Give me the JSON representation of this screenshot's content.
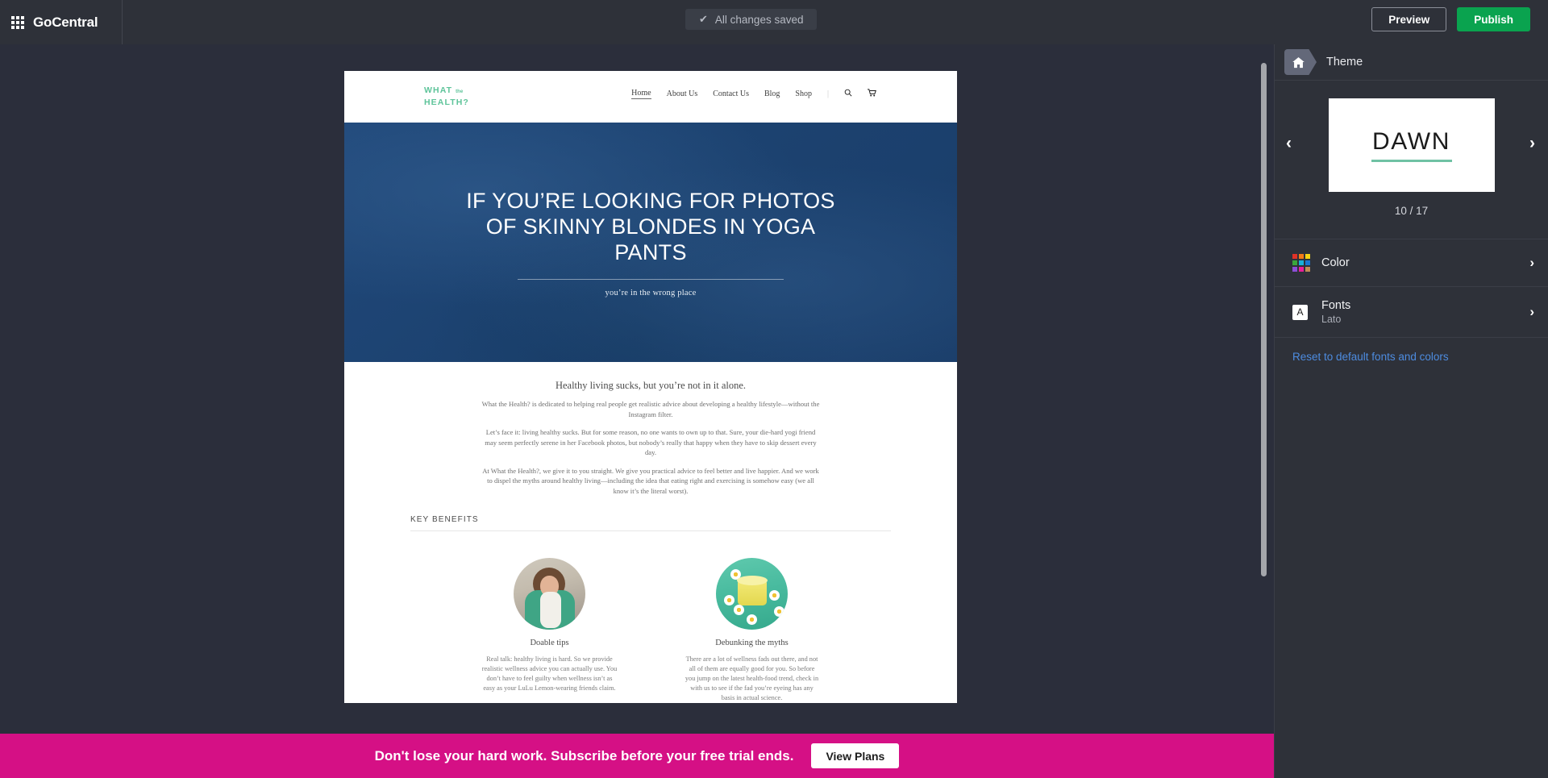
{
  "topbar": {
    "brand": "GoCentral",
    "waffle_icon": "apps-grid-icon",
    "save_status": "All changes saved",
    "check_glyph": "✔",
    "preview_label": "Preview",
    "publish_label": "Publish",
    "publish_color": "#0aa34f"
  },
  "site": {
    "logo_line1": "WHAT",
    "logo_small": "the",
    "logo_line2": "HEALTH",
    "logo_mark": "?",
    "logo_color": "#5ec49a",
    "nav": [
      {
        "label": "Home",
        "active": true
      },
      {
        "label": "About Us",
        "active": false
      },
      {
        "label": "Contact Us",
        "active": false
      },
      {
        "label": "Blog",
        "active": false
      },
      {
        "label": "Shop",
        "active": false
      }
    ],
    "nav_divider": "|",
    "search_glyph": "⚲",
    "cart_glyph": "Ὥ2",
    "hero": {
      "bg_color": "#1c4270",
      "title": "IF YOU’RE LOOKING FOR PHOTOS OF SKINNY BLONDES IN YOGA PANTS",
      "subtitle": "you’re in the wrong place"
    },
    "lead": "Healthy living sucks, but you’re not in it alone.",
    "paragraphs": [
      "What the Health? is dedicated to helping real people get realistic advice about developing a healthy lifestyle—without the Instagram filter.",
      "Let’s face it: living healthy sucks. But for some reason, no one wants to own up to that. Sure, your die-hard yogi friend may seem perfectly serene in her Facebook photos, but nobody’s really that happy when they have to skip dessert every day.",
      "At What the Health?, we give it to you straight. We give you practical advice to feel better and live happier. And we work to dispel the myths around healthy living—including the idea that eating right and exercising is somehow easy (we all know it’s the literal worst)."
    ],
    "key_benefits_title": "KEY BENEFITS",
    "cards": [
      {
        "caption": "Doable tips",
        "image": "woman-with-towel-photo",
        "body": "Real talk: healthy living is hard. So we provide realistic wellness advice you can actually use. You don’t have to feel guilty when wellness isn’t as easy as your LuLu Lemon-wearing friends claim."
      },
      {
        "caption": "Debunking the myths",
        "image": "cream-jar-with-daisies-photo",
        "body": "There are a lot of wellness fads out there, and not all of them are equally good for you. So before you jump on the latest health-food trend, check in with us to see if the fad you’re eyeing has any basis in actual science."
      }
    ]
  },
  "panel": {
    "home_icon": "home-icon",
    "title": "Theme",
    "theme": {
      "name": "DAWN",
      "underline_color": "#6fc2a4",
      "counter": "10 / 17",
      "prev_glyph": "‹",
      "next_glyph": "›"
    },
    "rows": [
      {
        "label": "Color",
        "sub": "",
        "icon": "color-palette-grid-icon",
        "chevron": "›",
        "swatch_colors": [
          "#e03127",
          "#f47b16",
          "#f5d312",
          "#3aa63a",
          "#18b0d8",
          "#1876d1",
          "#8b4fd6",
          "#e81e9a",
          "#c08c55"
        ]
      },
      {
        "label": "Fonts",
        "sub": "Lato",
        "icon": "font-letter-a-icon",
        "chevron": "›",
        "swatch_colors": []
      }
    ],
    "reset_label": "Reset to default fonts and colors",
    "reset_color": "#4d8ce0"
  },
  "banner": {
    "message": "Don't lose your hard work. Subscribe before your free trial ends.",
    "button_label": "View Plans",
    "bg_color": "#e40e8c"
  }
}
